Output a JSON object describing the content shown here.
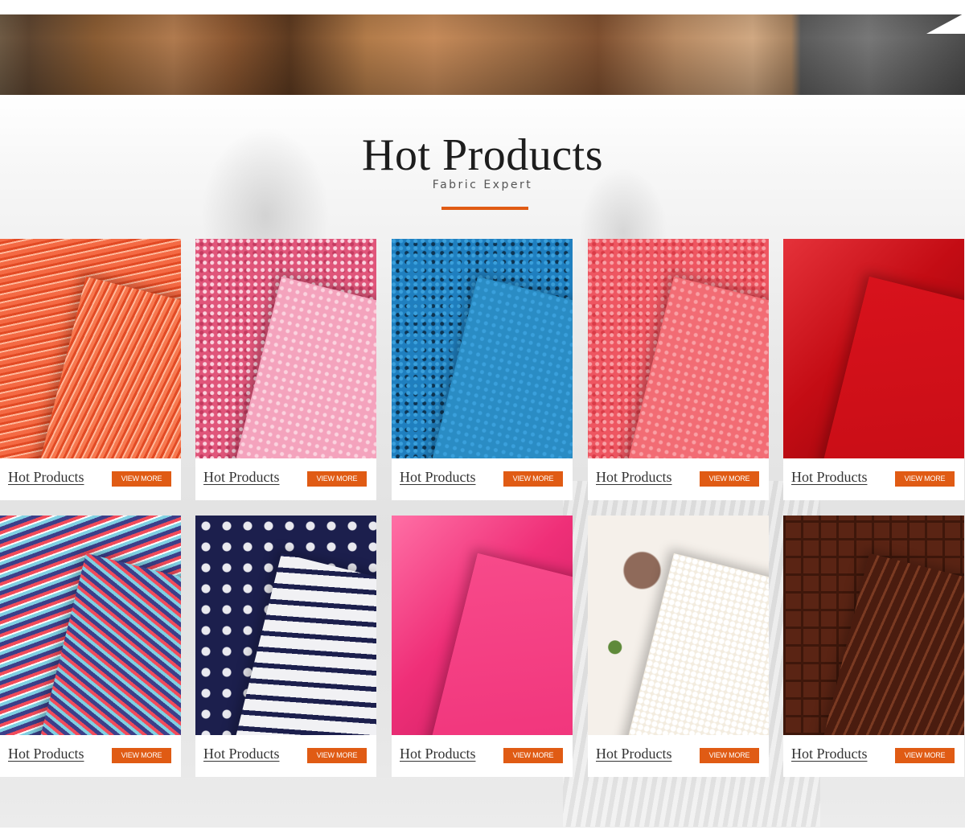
{
  "section": {
    "title": "Hot Products",
    "subtitle": "Fabric Expert"
  },
  "colors": {
    "accent": "#e05b14",
    "title_text": "#1d1d1d"
  },
  "products": [
    {
      "caption": "Hot Products",
      "button": "VIEW MORE",
      "base": "#f46a44",
      "light": "#ffb79a",
      "dark": "#e24a24",
      "fold": "#f7784f"
    },
    {
      "caption": "Hot Products",
      "button": "VIEW MORE",
      "base": "#e0557a",
      "light": "#fbd3df",
      "dark": "#c43a60",
      "fold": "#f4a3bd"
    },
    {
      "caption": "Hot Products",
      "button": "VIEW MORE",
      "base": "#1f7fbf",
      "light": "#3aa0dc",
      "dark": "#0d3350",
      "fold": "#2a8cc4"
    },
    {
      "caption": "Hot Products",
      "button": "VIEW MORE",
      "base": "#ee5661",
      "light": "#f9a0a5",
      "dark": "#d93b47",
      "fold": "#f26c74"
    },
    {
      "caption": "Hot Products",
      "button": "VIEW MORE",
      "base": "#c40c14",
      "light": "#e5323a",
      "dark": "#92050b",
      "fold": "#d8121c"
    },
    {
      "caption": "Hot Products",
      "button": "VIEW MORE",
      "base": "#3c3f8a",
      "light": "#7fd0e2",
      "dark": "#f24b5a",
      "fold": "#4b4f9e"
    },
    {
      "caption": "Hot Products",
      "button": "VIEW MORE",
      "base": "#1c1f4d",
      "light": "#e9e9ef",
      "dark": "#0f1130",
      "fold": "#f1f1f4"
    },
    {
      "caption": "Hot Products",
      "button": "VIEW MORE",
      "base": "#ef2f78",
      "light": "#ff6fa5",
      "dark": "#c71c5d",
      "fold": "#f74a8a"
    },
    {
      "caption": "Hot Products",
      "button": "VIEW MORE",
      "base": "#f5f0ea",
      "light": "#8f6a5a",
      "dark": "#5e3b2d",
      "fold": "#f3ecdf"
    },
    {
      "caption": "Hot Products",
      "button": "VIEW MORE",
      "base": "#5a2414",
      "light": "#7a3a22",
      "dark": "#3e170b",
      "fold": "#4a1c0f"
    }
  ]
}
